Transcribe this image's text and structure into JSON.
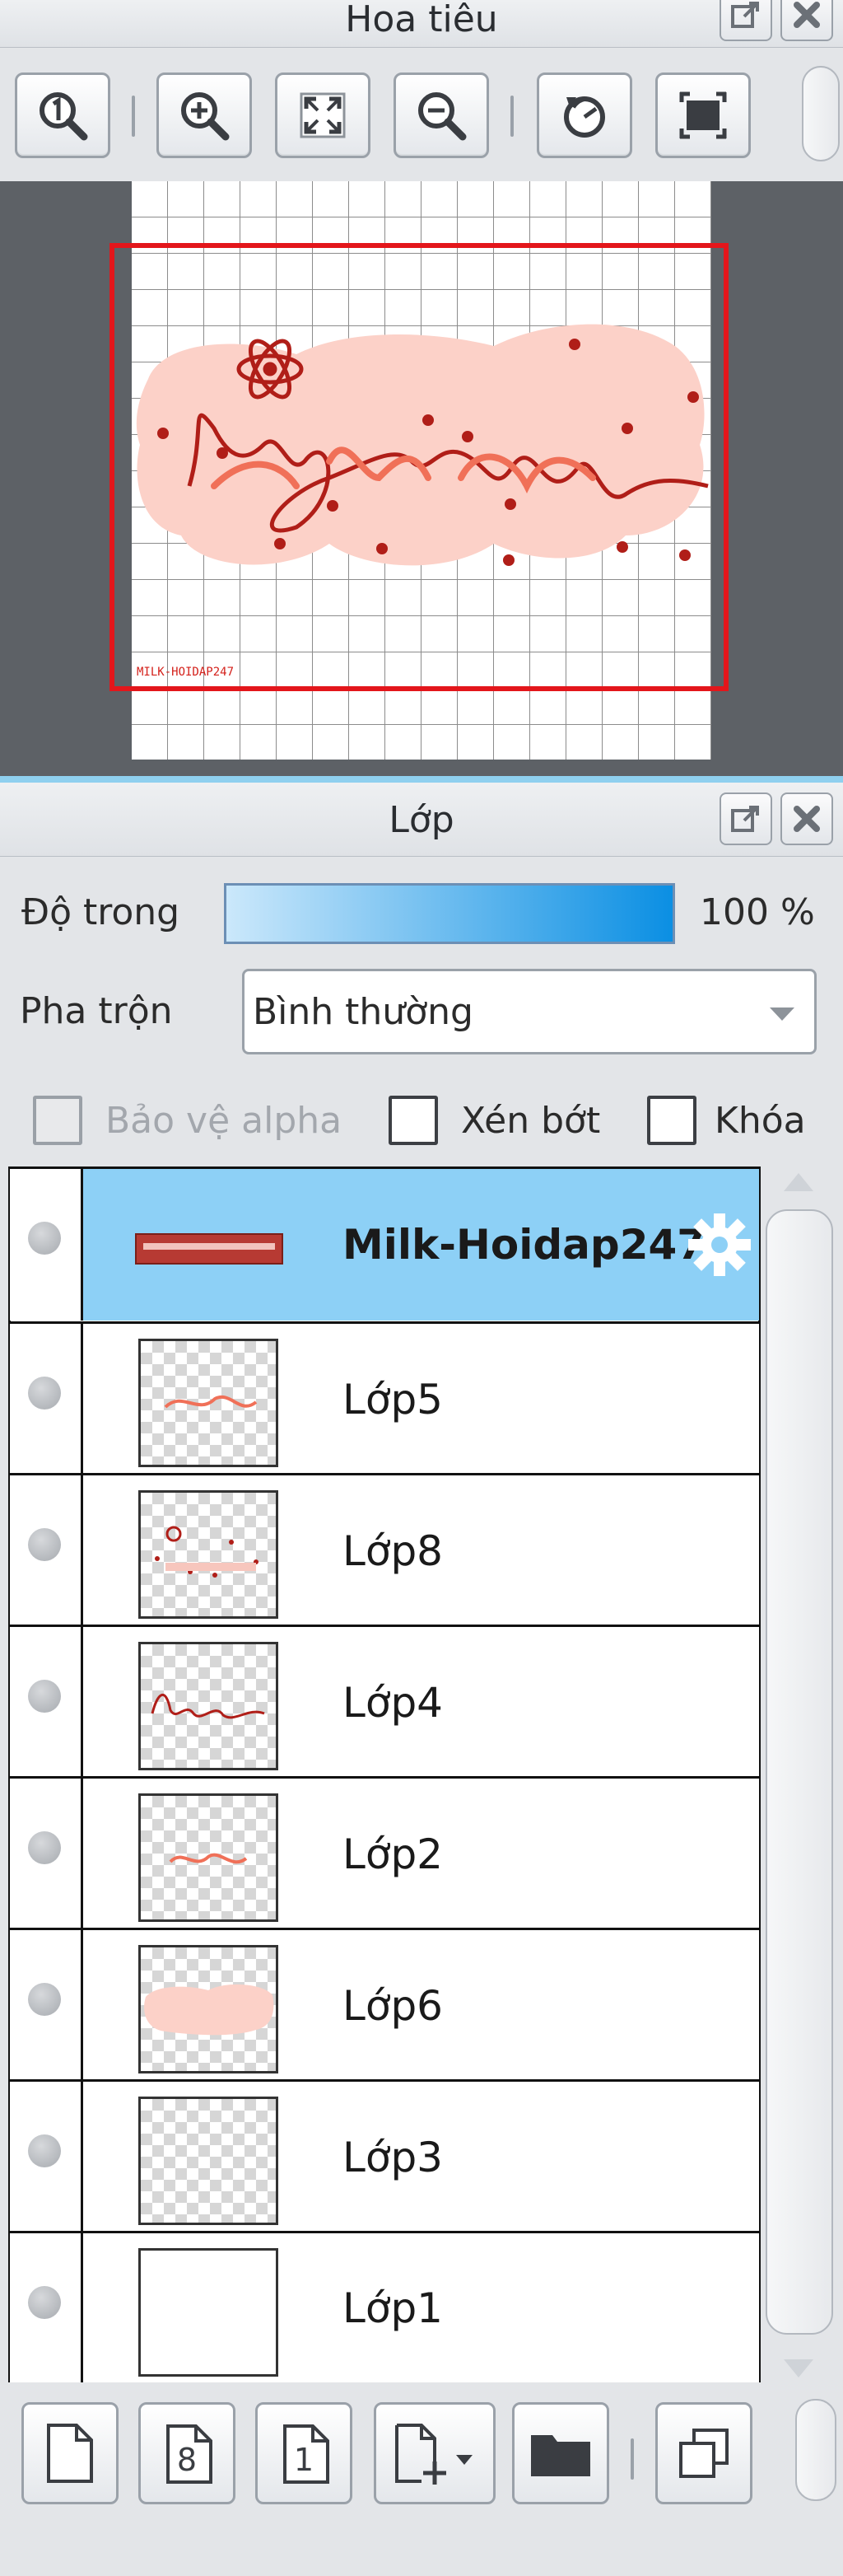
{
  "navigator": {
    "title": "Hoa tiêu",
    "toolbar": {
      "actual_size_icon": "magnifier-1-icon",
      "zoom_in_icon": "zoom-in-icon",
      "fit_icon": "fit-screen-icon",
      "zoom_out_icon": "zoom-out-icon",
      "rotate_icon": "rotate-icon",
      "fullscreen_icon": "fullscreen-icon"
    },
    "preview": {
      "text_main": "ngo ghe gom",
      "watermark": "MILK-HOIDAP247"
    }
  },
  "layers_panel": {
    "title": "Lớp",
    "opacity_label": "Độ trong",
    "opacity_value": "100 %",
    "opacity_fraction": 1.0,
    "blend_label": "Pha trộn",
    "blend_value": "Bình thường",
    "protect_alpha_label": "Bảo vệ alpha",
    "clipping_label": "Xén bớt",
    "lock_label": "Khóa",
    "layers": [
      {
        "name": "Milk-Hoidap247",
        "selected": true
      },
      {
        "name": "Lớp5"
      },
      {
        "name": "Lớp8"
      },
      {
        "name": "Lớp4"
      },
      {
        "name": "Lớp2"
      },
      {
        "name": "Lớp6"
      },
      {
        "name": "Lớp3"
      },
      {
        "name": "Lớp1"
      }
    ],
    "bottom_toolbar": {
      "new_layer_icon": "new-page-icon",
      "new_8bit_label": "8",
      "new_1bit_label": "1",
      "add_icon": "add-layer-icon",
      "folder_icon": "folder-icon",
      "duplicate_icon": "duplicate-icon"
    }
  },
  "colors": {
    "selection": "#8dd0f6",
    "accent_red": "#e3161b",
    "pink_blob": "#fcd1c8",
    "ink": "#b01e18",
    "text_orange": "#f07058",
    "canvas_bg": "#5d6166"
  }
}
